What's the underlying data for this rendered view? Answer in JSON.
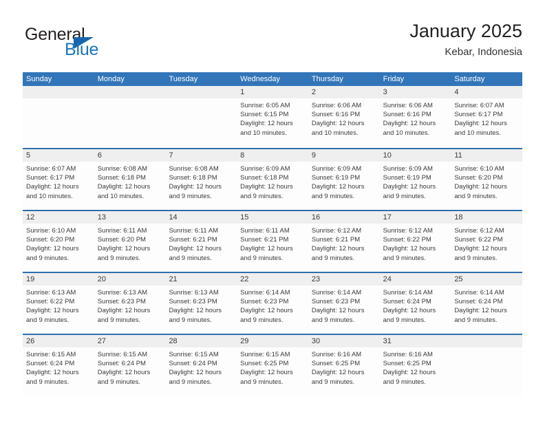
{
  "brand": {
    "word1": "General",
    "word2": "Blue",
    "triangle_color": "#1666ad",
    "blue_color": "#1b75bc"
  },
  "header": {
    "title": "January 2025",
    "subtitle": "Kebar, Indonesia"
  },
  "colors": {
    "header_bar": "#3275b9",
    "row_divider": "#2f6fad",
    "day_band": "#efefef",
    "text": "#3a3a3a"
  },
  "weekdays": [
    "Sunday",
    "Monday",
    "Tuesday",
    "Wednesday",
    "Thursday",
    "Friday",
    "Saturday"
  ],
  "weeks": [
    [
      {
        "day": "",
        "empty": true
      },
      {
        "day": "",
        "empty": true
      },
      {
        "day": "",
        "empty": true
      },
      {
        "day": "1",
        "sunrise": "Sunrise: 6:05 AM",
        "sunset": "Sunset: 6:15 PM",
        "daylight1": "Daylight: 12 hours",
        "daylight2": "and 10 minutes."
      },
      {
        "day": "2",
        "sunrise": "Sunrise: 6:06 AM",
        "sunset": "Sunset: 6:16 PM",
        "daylight1": "Daylight: 12 hours",
        "daylight2": "and 10 minutes."
      },
      {
        "day": "3",
        "sunrise": "Sunrise: 6:06 AM",
        "sunset": "Sunset: 6:16 PM",
        "daylight1": "Daylight: 12 hours",
        "daylight2": "and 10 minutes."
      },
      {
        "day": "4",
        "sunrise": "Sunrise: 6:07 AM",
        "sunset": "Sunset: 6:17 PM",
        "daylight1": "Daylight: 12 hours",
        "daylight2": "and 10 minutes."
      }
    ],
    [
      {
        "day": "5",
        "sunrise": "Sunrise: 6:07 AM",
        "sunset": "Sunset: 6:17 PM",
        "daylight1": "Daylight: 12 hours",
        "daylight2": "and 10 minutes."
      },
      {
        "day": "6",
        "sunrise": "Sunrise: 6:08 AM",
        "sunset": "Sunset: 6:18 PM",
        "daylight1": "Daylight: 12 hours",
        "daylight2": "and 10 minutes."
      },
      {
        "day": "7",
        "sunrise": "Sunrise: 6:08 AM",
        "sunset": "Sunset: 6:18 PM",
        "daylight1": "Daylight: 12 hours",
        "daylight2": "and 9 minutes."
      },
      {
        "day": "8",
        "sunrise": "Sunrise: 6:09 AM",
        "sunset": "Sunset: 6:18 PM",
        "daylight1": "Daylight: 12 hours",
        "daylight2": "and 9 minutes."
      },
      {
        "day": "9",
        "sunrise": "Sunrise: 6:09 AM",
        "sunset": "Sunset: 6:19 PM",
        "daylight1": "Daylight: 12 hours",
        "daylight2": "and 9 minutes."
      },
      {
        "day": "10",
        "sunrise": "Sunrise: 6:09 AM",
        "sunset": "Sunset: 6:19 PM",
        "daylight1": "Daylight: 12 hours",
        "daylight2": "and 9 minutes."
      },
      {
        "day": "11",
        "sunrise": "Sunrise: 6:10 AM",
        "sunset": "Sunset: 6:20 PM",
        "daylight1": "Daylight: 12 hours",
        "daylight2": "and 9 minutes."
      }
    ],
    [
      {
        "day": "12",
        "sunrise": "Sunrise: 6:10 AM",
        "sunset": "Sunset: 6:20 PM",
        "daylight1": "Daylight: 12 hours",
        "daylight2": "and 9 minutes."
      },
      {
        "day": "13",
        "sunrise": "Sunrise: 6:11 AM",
        "sunset": "Sunset: 6:20 PM",
        "daylight1": "Daylight: 12 hours",
        "daylight2": "and 9 minutes."
      },
      {
        "day": "14",
        "sunrise": "Sunrise: 6:11 AM",
        "sunset": "Sunset: 6:21 PM",
        "daylight1": "Daylight: 12 hours",
        "daylight2": "and 9 minutes."
      },
      {
        "day": "15",
        "sunrise": "Sunrise: 6:11 AM",
        "sunset": "Sunset: 6:21 PM",
        "daylight1": "Daylight: 12 hours",
        "daylight2": "and 9 minutes."
      },
      {
        "day": "16",
        "sunrise": "Sunrise: 6:12 AM",
        "sunset": "Sunset: 6:21 PM",
        "daylight1": "Daylight: 12 hours",
        "daylight2": "and 9 minutes."
      },
      {
        "day": "17",
        "sunrise": "Sunrise: 6:12 AM",
        "sunset": "Sunset: 6:22 PM",
        "daylight1": "Daylight: 12 hours",
        "daylight2": "and 9 minutes."
      },
      {
        "day": "18",
        "sunrise": "Sunrise: 6:12 AM",
        "sunset": "Sunset: 6:22 PM",
        "daylight1": "Daylight: 12 hours",
        "daylight2": "and 9 minutes."
      }
    ],
    [
      {
        "day": "19",
        "sunrise": "Sunrise: 6:13 AM",
        "sunset": "Sunset: 6:22 PM",
        "daylight1": "Daylight: 12 hours",
        "daylight2": "and 9 minutes."
      },
      {
        "day": "20",
        "sunrise": "Sunrise: 6:13 AM",
        "sunset": "Sunset: 6:23 PM",
        "daylight1": "Daylight: 12 hours",
        "daylight2": "and 9 minutes."
      },
      {
        "day": "21",
        "sunrise": "Sunrise: 6:13 AM",
        "sunset": "Sunset: 6:23 PM",
        "daylight1": "Daylight: 12 hours",
        "daylight2": "and 9 minutes."
      },
      {
        "day": "22",
        "sunrise": "Sunrise: 6:14 AM",
        "sunset": "Sunset: 6:23 PM",
        "daylight1": "Daylight: 12 hours",
        "daylight2": "and 9 minutes."
      },
      {
        "day": "23",
        "sunrise": "Sunrise: 6:14 AM",
        "sunset": "Sunset: 6:23 PM",
        "daylight1": "Daylight: 12 hours",
        "daylight2": "and 9 minutes."
      },
      {
        "day": "24",
        "sunrise": "Sunrise: 6:14 AM",
        "sunset": "Sunset: 6:24 PM",
        "daylight1": "Daylight: 12 hours",
        "daylight2": "and 9 minutes."
      },
      {
        "day": "25",
        "sunrise": "Sunrise: 6:14 AM",
        "sunset": "Sunset: 6:24 PM",
        "daylight1": "Daylight: 12 hours",
        "daylight2": "and 9 minutes."
      }
    ],
    [
      {
        "day": "26",
        "sunrise": "Sunrise: 6:15 AM",
        "sunset": "Sunset: 6:24 PM",
        "daylight1": "Daylight: 12 hours",
        "daylight2": "and 9 minutes."
      },
      {
        "day": "27",
        "sunrise": "Sunrise: 6:15 AM",
        "sunset": "Sunset: 6:24 PM",
        "daylight1": "Daylight: 12 hours",
        "daylight2": "and 9 minutes."
      },
      {
        "day": "28",
        "sunrise": "Sunrise: 6:15 AM",
        "sunset": "Sunset: 6:24 PM",
        "daylight1": "Daylight: 12 hours",
        "daylight2": "and 9 minutes."
      },
      {
        "day": "29",
        "sunrise": "Sunrise: 6:15 AM",
        "sunset": "Sunset: 6:25 PM",
        "daylight1": "Daylight: 12 hours",
        "daylight2": "and 9 minutes."
      },
      {
        "day": "30",
        "sunrise": "Sunrise: 6:16 AM",
        "sunset": "Sunset: 6:25 PM",
        "daylight1": "Daylight: 12 hours",
        "daylight2": "and 9 minutes."
      },
      {
        "day": "31",
        "sunrise": "Sunrise: 6:16 AM",
        "sunset": "Sunset: 6:25 PM",
        "daylight1": "Daylight: 12 hours",
        "daylight2": "and 9 minutes."
      },
      {
        "day": "",
        "empty": true
      }
    ]
  ]
}
